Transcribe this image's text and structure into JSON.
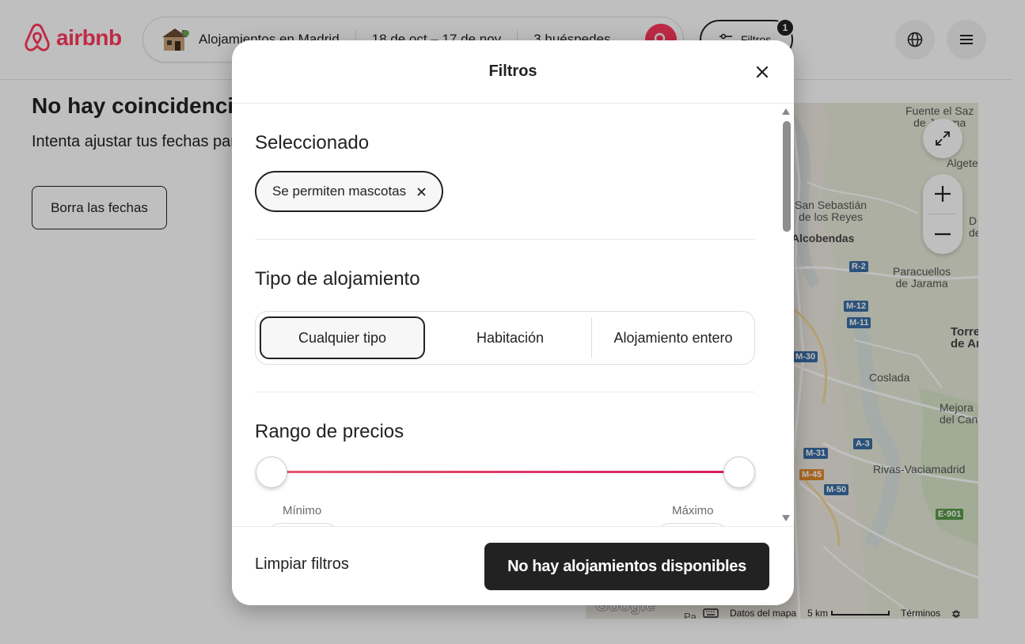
{
  "header": {
    "logo_text": "airbnb",
    "search": {
      "location": "Alojamientos en Madrid",
      "dates": "18 de oct – 17 de nov",
      "guests": "3 huéspedes"
    },
    "filters_label": "Filtros",
    "filters_badge": "1"
  },
  "results": {
    "title": "No hay coincidencias exactas",
    "subtitle": "Intenta ajustar tus fechas para ver más alojamientos",
    "clear_dates": "Borra las fechas"
  },
  "map": {
    "labels": {
      "fuente": "Fuente el Saz\nde Jarama",
      "algete": "Algete",
      "sanse": "San Sebastián\nde los Reyes",
      "alcobendas": "Alcobendas",
      "paracuellos": "Paracuellos\nde Jarama",
      "torrejon": "Torre\nde Ar",
      "coslada": "Coslada",
      "mejorada": "Mejora\ndel Can",
      "rivas": "Rivas-Vaciamadrid",
      "daganzo": "D\nde"
    },
    "signs": {
      "r2": "R-2",
      "m12": "M-12",
      "m11": "M-11",
      "m30": "M-30",
      "a3": "A-3",
      "m31": "M-31",
      "m45": "M-45",
      "m50": "M-50",
      "e901": "E-901"
    },
    "google": "Google",
    "footer": {
      "data": "Datos del mapa",
      "scale": "5 km",
      "terms": "Términos"
    },
    "bottom_partial": "Pa"
  },
  "modal": {
    "title": "Filtros",
    "selected": {
      "title": "Seleccionado",
      "chip": "Se permiten mascotas"
    },
    "type": {
      "title": "Tipo de alojamiento",
      "options": [
        "Cualquier tipo",
        "Habitación",
        "Alojamiento entero"
      ],
      "selected_index": 0
    },
    "price": {
      "title": "Rango de precios",
      "min_label": "Mínimo",
      "max_label": "Máximo"
    },
    "footer": {
      "clear": "Limpiar filtros",
      "show": "No hay alojamientos disponibles"
    }
  },
  "colors": {
    "brand": "#ff385c",
    "dark": "#222222"
  }
}
